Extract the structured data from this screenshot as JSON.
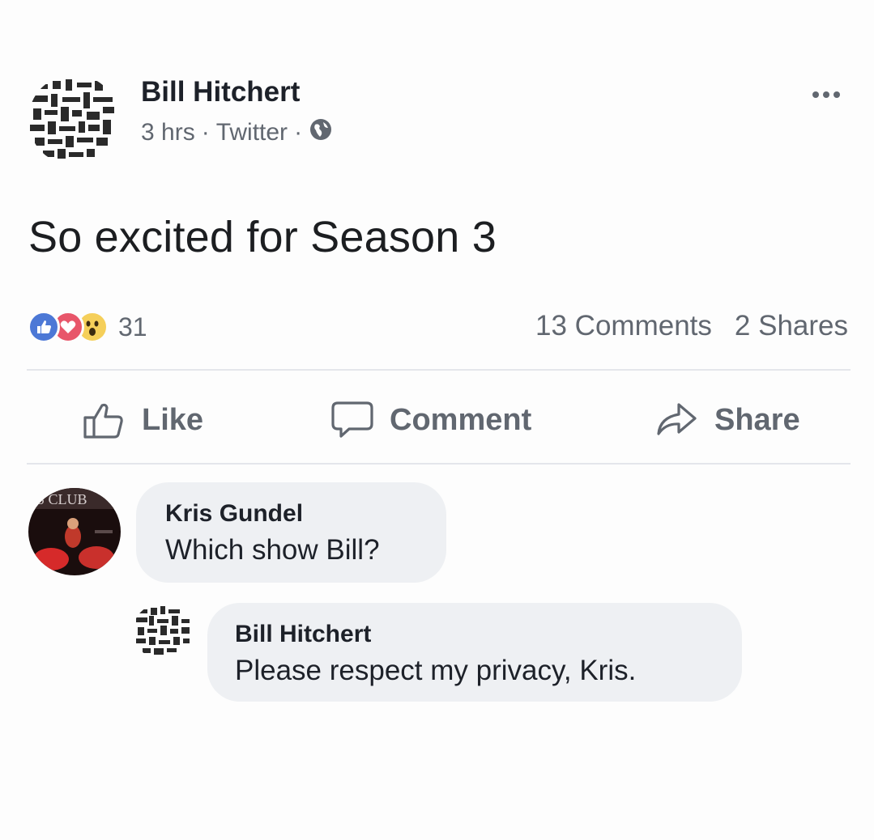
{
  "post": {
    "author": "Bill Hitchert",
    "time": "3 hrs",
    "separator": "·",
    "source": "Twitter",
    "privacy_icon": "globe-icon",
    "text": "So excited for Season 3",
    "reactions": {
      "icons": [
        "like-reaction-icon",
        "love-reaction-icon",
        "wow-reaction-icon"
      ],
      "count": "31"
    },
    "comments_count": "13 Comments",
    "shares_count": "2 Shares"
  },
  "actions": {
    "like": "Like",
    "comment": "Comment",
    "share": "Share"
  },
  "comments": [
    {
      "author": "Kris Gundel",
      "text": "Which show Bill?"
    },
    {
      "author": "Bill Hitchert",
      "text": "Please respect my privacy, Kris."
    }
  ],
  "colors": {
    "like_blue": "#4c78d6",
    "love_red": "#e8566a",
    "wow_yellow": "#f5cf5a",
    "secondary_text": "#616770",
    "bubble_bg": "#eef0f3"
  }
}
